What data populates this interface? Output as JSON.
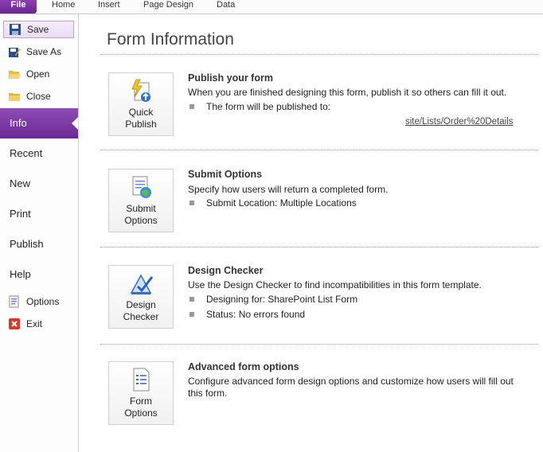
{
  "ribbon": {
    "tabs": [
      "File",
      "Home",
      "Insert",
      "Page Design",
      "Data"
    ]
  },
  "nav": {
    "commands_top": [
      "Save",
      "Save As",
      "Open",
      "Close"
    ],
    "tabs": [
      "Info",
      "Recent",
      "New",
      "Print",
      "Publish",
      "Help"
    ],
    "commands_bottom": [
      "Options",
      "Exit"
    ]
  },
  "main": {
    "title": "Form Information",
    "sections": [
      {
        "button": [
          "Quick",
          "Publish"
        ],
        "heading": "Publish your form",
        "text": "When you are finished designing this form, publish it so others can fill it out.",
        "bullets": [
          "The form will be published to:"
        ],
        "url_visible": "site/Lists/Order%20Details"
      },
      {
        "button": [
          "Submit",
          "Options"
        ],
        "heading": "Submit Options",
        "text": "Specify how users will return a completed form.",
        "bullets": [
          "Submit Location: Multiple Locations"
        ]
      },
      {
        "button": [
          "Design",
          "Checker"
        ],
        "heading": "Design Checker",
        "text": "Use the Design Checker to find incompatibilities in this form template.",
        "bullets": [
          "Designing for: SharePoint List Form",
          "Status: No errors found"
        ]
      },
      {
        "button": [
          "Form",
          "Options"
        ],
        "heading": "Advanced form options",
        "text": "Configure advanced form design options and customize how users will fill out this form.",
        "bullets": []
      }
    ]
  },
  "colors": {
    "accent": "#7a34a3",
    "file_tab": "#7b3aa5"
  }
}
